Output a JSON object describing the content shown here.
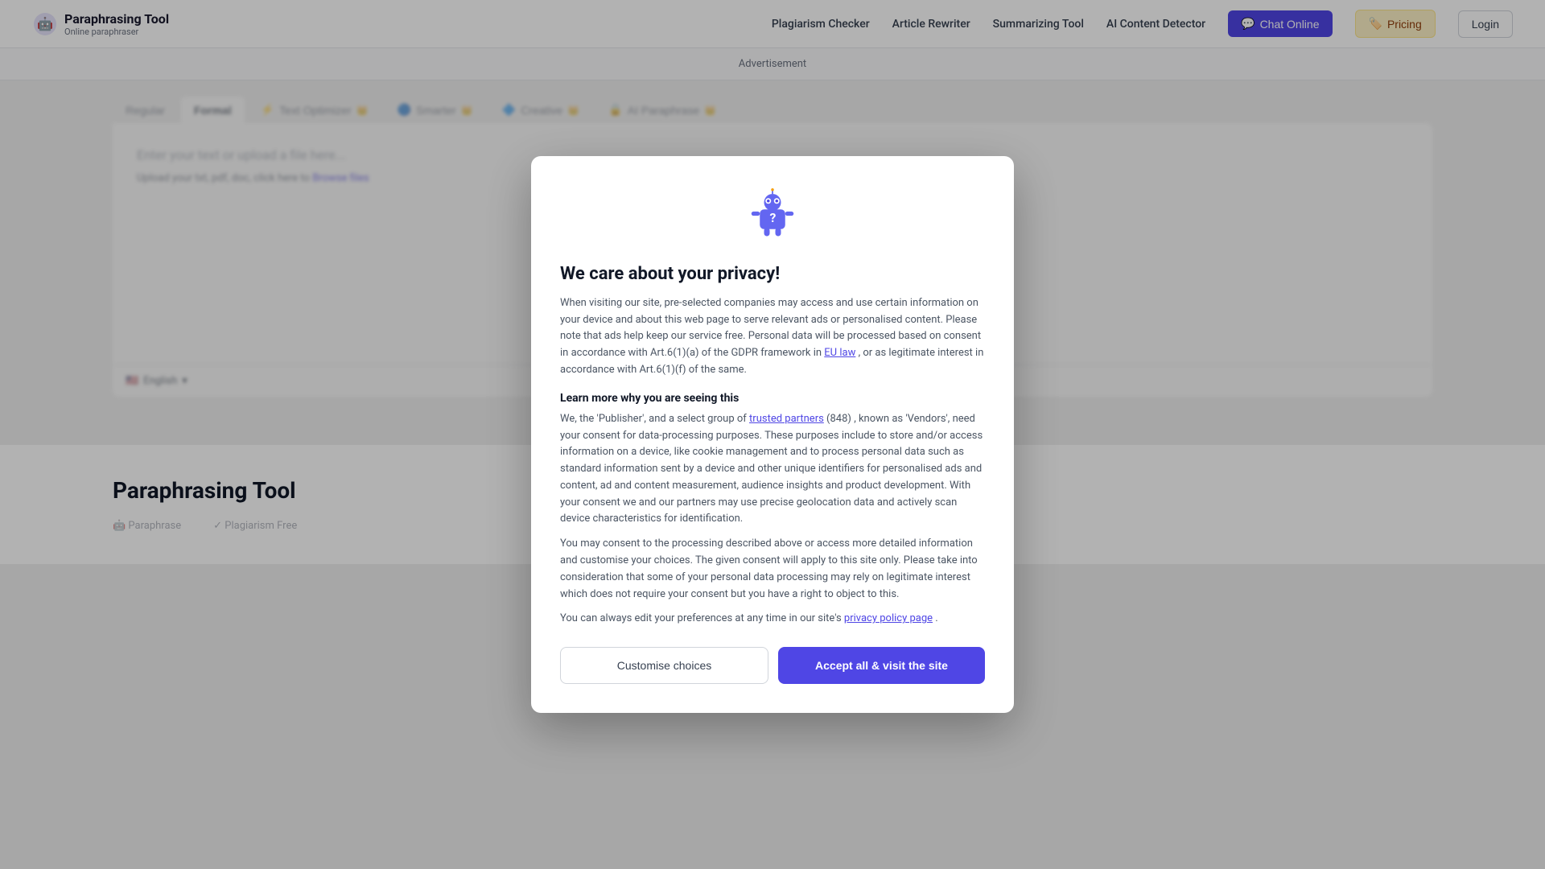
{
  "header": {
    "logo_title": "Paraphrasing Tool",
    "logo_subtitle": "Online paraphraser",
    "nav": {
      "plagiarism_checker": "Plagiarism Checker",
      "article_rewriter": "Article Rewriter",
      "summarizing_tool": "Summarizing Tool",
      "ai_content_detector": "AI Content Detector",
      "chat_online": "Chat Online",
      "pricing": "Pricing",
      "login": "Login"
    }
  },
  "ad_bar": {
    "text": "Advertisement"
  },
  "editor": {
    "tabs": [
      {
        "label": "Regular",
        "active": false,
        "premium": false
      },
      {
        "label": "Formal",
        "active": true,
        "premium": false
      },
      {
        "label": "Text Optimizer",
        "active": false,
        "premium": true
      },
      {
        "label": "Smarter",
        "active": false,
        "premium": true
      },
      {
        "label": "Creative",
        "active": false,
        "premium": true
      },
      {
        "label": "AI Paraphrase",
        "active": false,
        "premium": true
      }
    ],
    "placeholder": "Enter your text or upload a file here...",
    "upload_text": "Upload your txt, pdf, doc, click here to",
    "browse_label": "Browse files",
    "language": "English"
  },
  "modal": {
    "title": "We care about your privacy!",
    "body_1": "When visiting our site, pre-selected companies may access and use certain information on your device and about this web page to serve relevant ads or personalised content. Please note that ads help keep our service free. Personal data will be processed based on consent in accordance with Art.6(1)(a) of the GDPR framework in",
    "eu_law_link": "EU law",
    "body_1_end": ", or as legitimate interest in accordance with Art.6(1)(f) of the same.",
    "learn_title": "Learn more why you are seeing this",
    "body_2_pre": "We, the 'Publisher', and a select group of",
    "trusted_partners_link": "trusted partners",
    "body_2_count": "(848)",
    "body_2_mid": ", known as 'Vendors', need your consent for data-processing purposes. These purposes include to store and/or access information on a device, like cookie management and to process personal data such as standard information sent by a device and other unique identifiers for personalised ads and content, ad and content measurement, audience insights and product development. With your consent we and our partners may use precise geolocation data and actively scan device characteristics for identification.",
    "body_3": "You may consent to the processing described above or access more detailed information and customise your choices. The given consent will apply to this site only. Please take into consideration that some of your personal data processing may rely on legitimate interest which does not require your consent but you have a right to object to this.",
    "body_4_pre": "You can always edit your preferences at any time in our site's",
    "privacy_policy_link": "privacy policy page",
    "body_4_end": ".",
    "btn_customise": "Customise choices",
    "btn_accept": "Accept all & visit the site"
  },
  "bottom": {
    "title": "Paraphrasing Tool",
    "logo1": "Paraphrase",
    "logo2": "Plagiarism Free"
  }
}
